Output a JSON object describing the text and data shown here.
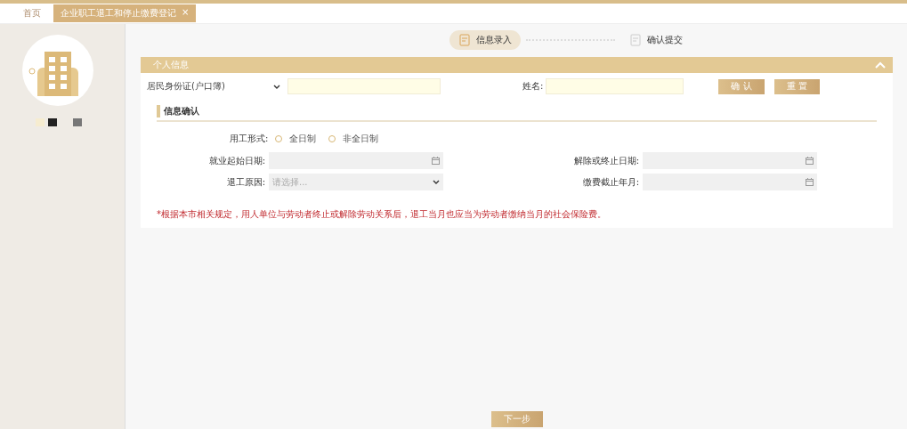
{
  "tabs": [
    {
      "label": "首页",
      "selected": false,
      "closable": false
    },
    {
      "label": "企业职工退工和停止缴费登记",
      "selected": true,
      "closable": true
    }
  ],
  "close_glyph": "×",
  "steps": [
    {
      "label": "信息录入",
      "selected": true
    },
    {
      "label": "确认提交",
      "selected": false
    }
  ],
  "panel": {
    "title": "个人信息",
    "id_type": {
      "value": "居民身份证(户口簿)"
    },
    "name_label": "姓名:",
    "buttons": [
      "确 认",
      "重 置"
    ]
  },
  "section": {
    "title": "信息确认"
  },
  "employment_type": {
    "label": "用工形式:",
    "options": [
      {
        "label": "全日制",
        "selected": false
      },
      {
        "label": "非全日制",
        "selected": false
      }
    ]
  },
  "fields": [
    {
      "label": "就业起始日期:",
      "kind": "date"
    },
    {
      "label": "解除或终止日期:",
      "kind": "date"
    },
    {
      "label": "退工原因:",
      "kind": "select",
      "placeholder": "请选择..."
    },
    {
      "label": "缴费截止年月:",
      "kind": "date"
    }
  ],
  "notice": "*根据本市相关规定，用人单位与劳动者终止或解除劳动关系后，退工当月也应当为劳动者缴纳当月的社会保险费。",
  "next_button": "下一步"
}
